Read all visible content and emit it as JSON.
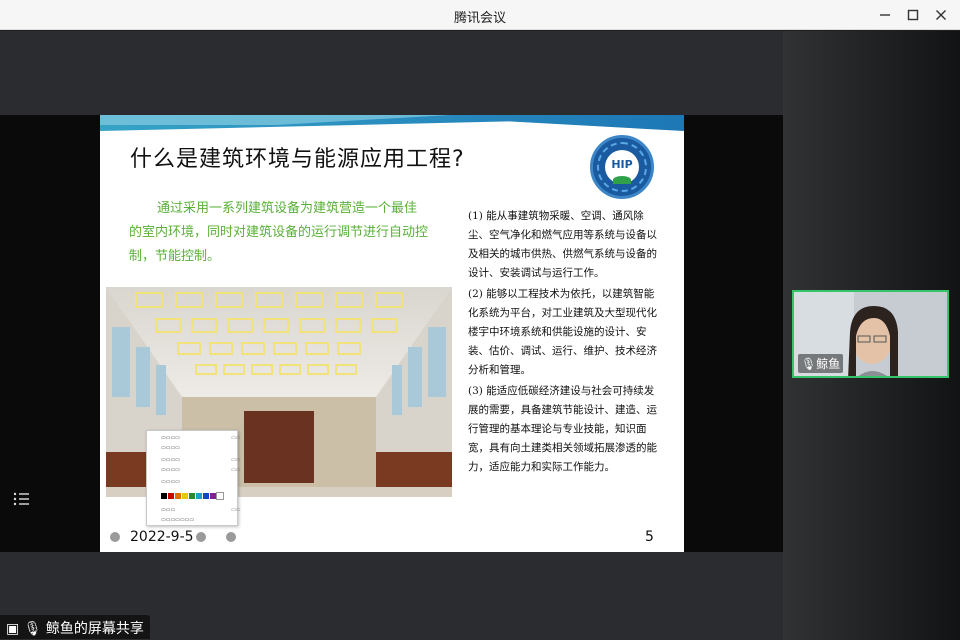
{
  "window": {
    "title": "腾讯会议",
    "controls": {
      "minimize": "minimize-icon",
      "maximize": "maximize-icon",
      "close": "close-icon"
    }
  },
  "slide": {
    "title": "什么是建筑环境与能源应用工程?",
    "logo_text": "HIP",
    "intro": "通过采用一系列建筑设备为建筑营造一个最佳的室内环境，同时对建筑设备的运行调节进行自动控制，节能控制。",
    "items": [
      "(1) 能从事建筑物采暖、空调、通风除尘、空气净化和燃气应用等系统与设备以及相关的城市供热、供燃气系统与设备的设计、安装调试与运行工作。",
      "(2) 能够以工程技术为依托，以建筑智能化系统为平台，对工业建筑及大型现代化楼宇中环境系统和供能设施的设计、安装、估价、调试、运行、维护、技术经济分析和管理。",
      "(3) 能适应低碳经济建设与社会可持续发展的需要，具备建筑节能设计、建造、运行管理的基本理论与专业技能，知识面宽，具有向土建类相关领域拓展渗透的能力，适应能力和实际工作能力。"
    ],
    "date": "2022-9-5",
    "page_number": "5"
  },
  "participant": {
    "name": "鲸鱼"
  },
  "share_label": "鲸鱼的屏幕共享",
  "colors": {
    "accent_green": "#35c46a",
    "intro_text": "#59b037",
    "slide_band": "#1d77b6"
  }
}
